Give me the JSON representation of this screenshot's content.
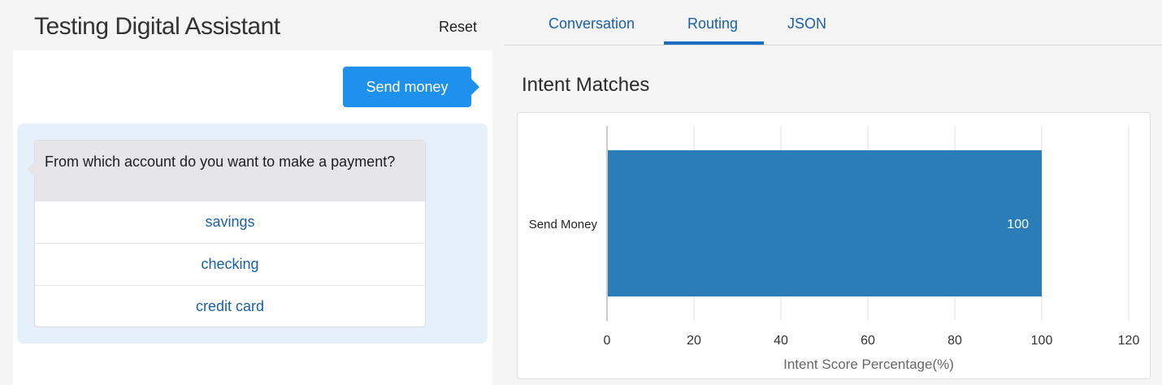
{
  "app_title": "Testing Digital Assistant",
  "reset_label": "Reset",
  "chat": {
    "user_message": "Send money",
    "bot_message": "From which account do you want to make a payment?",
    "options": [
      "savings",
      "checking",
      "credit card"
    ]
  },
  "tabs": [
    {
      "label": "Conversation",
      "active": false
    },
    {
      "label": "Routing",
      "active": true
    },
    {
      "label": "JSON",
      "active": false
    }
  ],
  "section_title": "Intent Matches",
  "colors": {
    "accent": "#1e90ee",
    "bar": "#2a7db6",
    "link": "#1a5fa8"
  },
  "chart_data": {
    "type": "bar",
    "orientation": "horizontal",
    "categories": [
      "Send Money"
    ],
    "values": [
      100
    ],
    "data_labels": [
      "100"
    ],
    "xlabel": "Intent Score Percentage(%)",
    "xlim": [
      0,
      120
    ],
    "xticks": [
      0,
      20,
      40,
      60,
      80,
      100,
      120
    ],
    "grid": true
  }
}
